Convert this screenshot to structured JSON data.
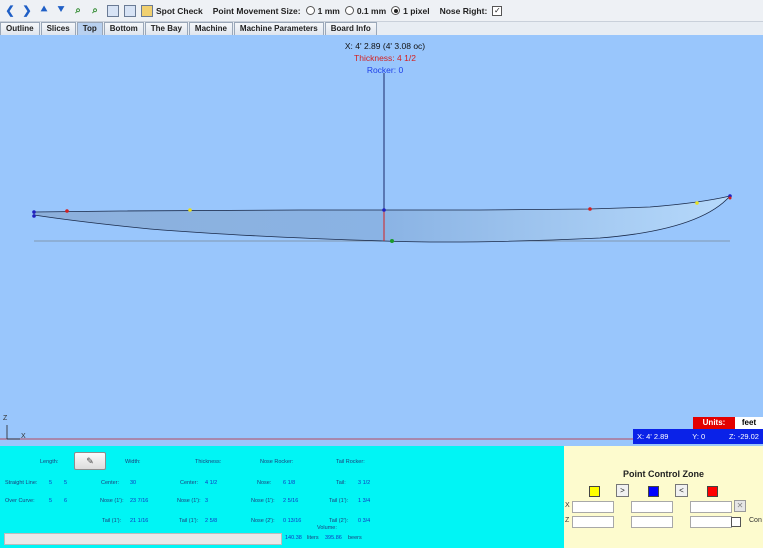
{
  "toolbar": {
    "spot_check": "Spot Check",
    "point_movement_label": "Point Movement Size:",
    "options": [
      "1 mm",
      "0.1 mm",
      "1 pixel"
    ],
    "selected_option": "1 pixel",
    "nose_right_label": "Nose Right:",
    "nose_right_checked": true
  },
  "tabs": [
    "Outline",
    "Slices",
    "Top",
    "Bottom",
    "The Bay",
    "Machine",
    "Machine Parameters",
    "Board Info"
  ],
  "active_tab": "Top",
  "readout": {
    "x": "X: 4' 2.89 (4' 3.08 oc)",
    "thickness": "Thickness: 4 1/2",
    "rocker": "Rocker: 0"
  },
  "colors": {
    "canvas_bg": "#99c6fc",
    "thickness_text": "#d42020",
    "rocker_text": "#1e3fe8",
    "panel_bg": "#00f5f5",
    "control_zone_bg": "#fdfbce",
    "units_label_bg": "#e30000",
    "coord_bar_bg": "#0a22e8"
  },
  "axis": {
    "z": "Z",
    "x": "X"
  },
  "units": {
    "label": "Units:",
    "value": "feet"
  },
  "coords": {
    "x": "X: 4' 2.89",
    "y": "Y: 0",
    "z": "Z: -29.02"
  },
  "measurements": {
    "length_label": "Length:",
    "width_label": "Width:",
    "thickness_label": "Thickness:",
    "nose_rocker_label": "Nose Rocker:",
    "tail_rocker_label": "Tail Rocker:",
    "straight_line_label": "Straight Line:",
    "straight_line_feet": "5",
    "straight_line_inches": "5",
    "over_curve_label": "Over Curve:",
    "over_curve_feet": "5",
    "over_curve_inches": "6",
    "width_center_label": "Center:",
    "width_center": "30",
    "width_nose1_label": "Nose (1'):",
    "width_nose1": "23 7/16",
    "width_tail1_label": "Tail (1'):",
    "width_tail1": "21 1/16",
    "thick_center_label": "Center:",
    "thick_center": "4 1/2",
    "thick_nose1_label": "Nose (1'):",
    "thick_nose1": "3",
    "thick_tail1_label": "Tail (1'):",
    "thick_tail1": "2 5/8",
    "nose_rocker_nose_label": "Nose:",
    "nose_rocker_nose": "6 1/8",
    "nose_rocker_nose1_label": "Nose (1'):",
    "nose_rocker_nose1": "2 5/16",
    "nose_rocker_nose2_label": "Nose (2'):",
    "nose_rocker_nose2": "0 13/16",
    "tail_rocker_tail_label": "Tail:",
    "tail_rocker_tail": "3 1/2",
    "tail_rocker_tail1_label": "Tail (1'):",
    "tail_rocker_tail1": "1 3/4",
    "tail_rocker_tail2_label": "Tail (2'):",
    "tail_rocker_tail2": "0 3/4",
    "volume_label": "Volume:",
    "volume_liters": "140.38",
    "liters_label": "liters",
    "volume_beers": "395.86",
    "beers_label": "beers"
  },
  "point_control": {
    "title": "Point Control Zone",
    "x_label": "X",
    "z_label": "Z",
    "cont_label": "Con",
    "nav_prev": "<",
    "nav_next": ">",
    "square_colors": [
      "#ffff00",
      "#0000ff",
      "#ff0000"
    ]
  }
}
